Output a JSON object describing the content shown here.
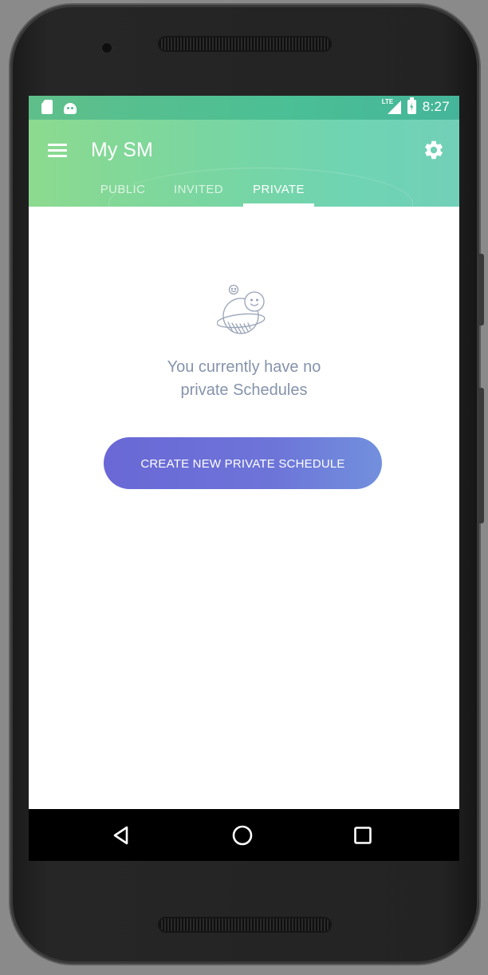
{
  "status_bar": {
    "clock": "8:27",
    "network_label": "LTE",
    "icons": [
      "sd-card-icon",
      "android-debug-icon",
      "lte-signal-icon",
      "battery-charging-icon"
    ]
  },
  "app_bar": {
    "title": "My SM",
    "menu_icon": "hamburger-menu-icon",
    "settings_icon": "gear-icon"
  },
  "tabs": [
    {
      "label": "PUBLIC",
      "active": false
    },
    {
      "label": "INVITED",
      "active": false
    },
    {
      "label": "PRIVATE",
      "active": true
    }
  ],
  "empty_state": {
    "illustration": "smiley-planet-illustration",
    "line1": "You currently have no",
    "line2": "private Schedules"
  },
  "create_button": {
    "label": "CREATE NEW PRIVATE SCHEDULE"
  },
  "nav_bar": {
    "back_icon": "back-triangle-icon",
    "home_icon": "home-circle-icon",
    "recents_icon": "recents-square-icon"
  },
  "colors": {
    "header_start": "#8cda8f",
    "header_end": "#72d0b8",
    "button_start": "#6a68d6",
    "button_end": "#7290dd",
    "empty_text": "#8593ab"
  }
}
